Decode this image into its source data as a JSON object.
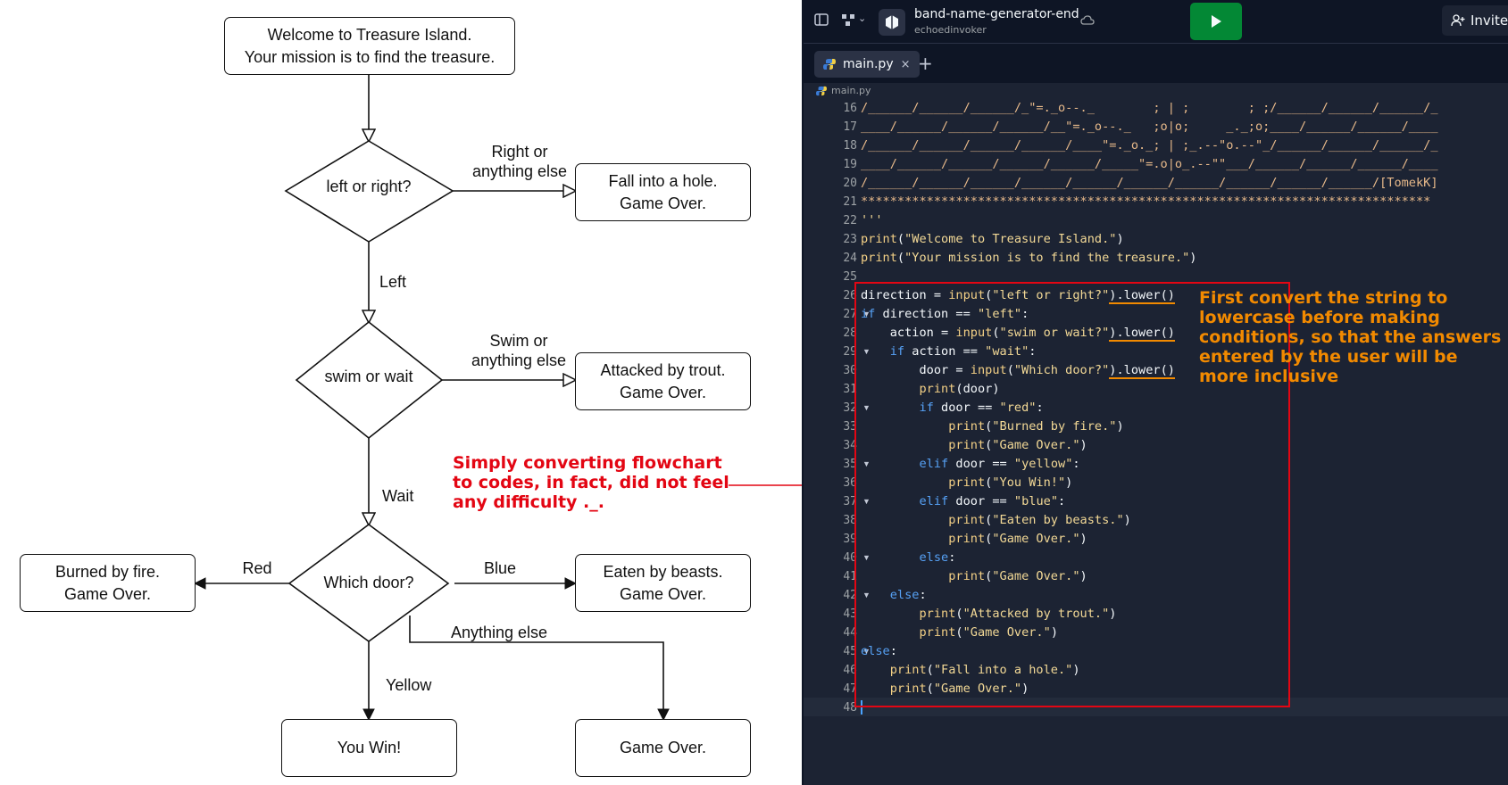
{
  "flowchart": {
    "start": "Welcome to Treasure Island.\nYour mission is to find the treasure.",
    "decision1": "left or right?",
    "edge_right": "Right or\nanything else",
    "end_hole": "Fall into a hole.\nGame Over.",
    "edge_left": "Left",
    "decision2": "swim or wait",
    "edge_swim": "Swim or\nanything else",
    "end_trout": "Attacked by trout.\nGame Over.",
    "edge_wait": "Wait",
    "decision3": "Which door?",
    "edge_red": "Red",
    "end_fire": "Burned by fire.\nGame Over.",
    "edge_blue": "Blue",
    "end_beasts": "Eaten by beasts.\nGame Over.",
    "edge_anything": "Anything else",
    "edge_yellow": "Yellow",
    "end_win": "You Win!",
    "end_gameover": "Game Over."
  },
  "annotations": {
    "red_note": "Simply converting flowchart\nto codes, in fact, did not feel\nany difficulty ._.",
    "orange_note": "First convert the string to lowercase before making conditions, so that the answers entered by the user will be more inclusive",
    "red_color": "#e30613",
    "orange_color": "#f28a00"
  },
  "ide": {
    "repl_name": "band-name-generator-end",
    "repl_owner": "echoedinvoker",
    "invite_label": "Invite",
    "tab_label": "main.py",
    "breadcrumb": "main.py",
    "run_color": "#038835",
    "icons": [
      "sidebar-toggle-icon",
      "git-branch-icon",
      "chevron-down-icon",
      "repl-logo-icon",
      "cloud-sync-icon",
      "play-icon",
      "add-user-icon",
      "python-icon",
      "close-icon",
      "plus-icon"
    ],
    "line_numbers": [
      "16",
      "17",
      "18",
      "19",
      "20",
      "21",
      "22",
      "23",
      "24",
      "25",
      "26",
      "27",
      "28",
      "29",
      "30",
      "31",
      "32",
      "33",
      "34",
      "35",
      "36",
      "37",
      "38",
      "39",
      "40",
      "41",
      "42",
      "43",
      "44",
      "45",
      "46",
      "47",
      "48"
    ],
    "code": {
      "l16": "/______/______/______/_\"=._o--._        ; | ;        ; ;/______/______/______/_",
      "l17": "____/______/______/______/__\"=._o--._   ;o|o;     _._;o;____/______/______/____",
      "l18": "/______/______/______/______/____\"=._o._; | ;_.--\"o.--\"_/______/______/______/_",
      "l19": "____/______/______/______/______/_____\"=.o|o_.--\"\"___/______/______/______/____",
      "l20": "/______/______/______/______/______/______/______/______/______/______/[TomekK]",
      "l21": "******************************************************************************",
      "l22": "'''",
      "l23_fn": "print",
      "l23_str": "\"Welcome to Treasure Island.\"",
      "l24_fn": "print",
      "l24_str": "\"Your mission is to find the treasure.\"",
      "l26_var": "direction = ",
      "l26_fn": "input",
      "l26_str": "\"left or right?\"",
      "l26_tail": ").lower()",
      "l27_kw": "if",
      "l27_mid": " direction == ",
      "l27_str": "\"left\"",
      "l28_var": "    action = ",
      "l28_fn": "input",
      "l28_str": "\"swim or wait?\"",
      "l28_tail": ").lower()",
      "l29_kw": "if",
      "l29_mid": " action == ",
      "l29_str": "\"wait\"",
      "l30_var": "        door = ",
      "l30_fn": "input",
      "l30_str": "\"Which door?\"",
      "l30_tail": ").lower()",
      "l31_fn": "print",
      "l31_arg": "(door)",
      "l32_kw": "if",
      "l32_mid": " door == ",
      "l32_str": "\"red\"",
      "l33_str": "\"Burned by fire.\"",
      "l34_str": "\"Game Over.\"",
      "l35_kw": "elif",
      "l35_str": "\"yellow\"",
      "l36_str": "\"You Win!\"",
      "l37_kw": "elif",
      "l37_str": "\"blue\"",
      "l38_str": "\"Eaten by beasts.\"",
      "l39_str": "\"Game Over.\"",
      "l40_kw": "else",
      "l41_str": "\"Game Over.\"",
      "l42_kw": "else",
      "l43_str": "\"Attacked by trout.\"",
      "l44_str": "\"Game Over.\"",
      "l45_kw": "else",
      "l46_str": "\"Fall into a hole.\"",
      "l47_str": "\"Game Over.\""
    }
  }
}
